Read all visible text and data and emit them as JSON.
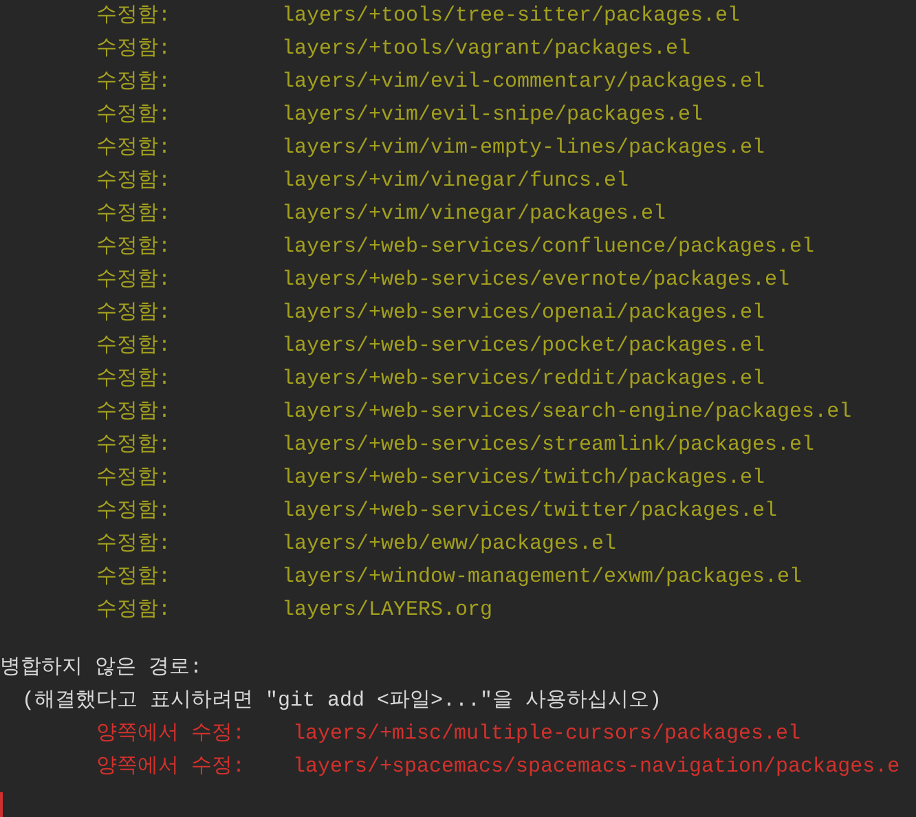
{
  "lines": [
    {
      "kind": "modified",
      "status": "수정함:",
      "path": "layers/+tools/tree-sitter/packages.el"
    },
    {
      "kind": "modified",
      "status": "수정함:",
      "path": "layers/+tools/vagrant/packages.el"
    },
    {
      "kind": "modified",
      "status": "수정함:",
      "path": "layers/+vim/evil-commentary/packages.el"
    },
    {
      "kind": "modified",
      "status": "수정함:",
      "path": "layers/+vim/evil-snipe/packages.el"
    },
    {
      "kind": "modified",
      "status": "수정함:",
      "path": "layers/+vim/vim-empty-lines/packages.el"
    },
    {
      "kind": "modified",
      "status": "수정함:",
      "path": "layers/+vim/vinegar/funcs.el"
    },
    {
      "kind": "modified",
      "status": "수정함:",
      "path": "layers/+vim/vinegar/packages.el"
    },
    {
      "kind": "modified",
      "status": "수정함:",
      "path": "layers/+web-services/confluence/packages.el"
    },
    {
      "kind": "modified",
      "status": "수정함:",
      "path": "layers/+web-services/evernote/packages.el"
    },
    {
      "kind": "modified",
      "status": "수정함:",
      "path": "layers/+web-services/openai/packages.el"
    },
    {
      "kind": "modified",
      "status": "수정함:",
      "path": "layers/+web-services/pocket/packages.el"
    },
    {
      "kind": "modified",
      "status": "수정함:",
      "path": "layers/+web-services/reddit/packages.el"
    },
    {
      "kind": "modified",
      "status": "수정함:",
      "path": "layers/+web-services/search-engine/packages.el"
    },
    {
      "kind": "modified",
      "status": "수정함:",
      "path": "layers/+web-services/streamlink/packages.el"
    },
    {
      "kind": "modified",
      "status": "수정함:",
      "path": "layers/+web-services/twitch/packages.el"
    },
    {
      "kind": "modified",
      "status": "수정함:",
      "path": "layers/+web-services/twitter/packages.el"
    },
    {
      "kind": "modified",
      "status": "수정함:",
      "path": "layers/+web/eww/packages.el"
    },
    {
      "kind": "modified",
      "status": "수정함:",
      "path": "layers/+window-management/exwm/packages.el"
    },
    {
      "kind": "modified",
      "status": "수정함:",
      "path": "layers/LAYERS.org"
    },
    {
      "kind": "blank"
    },
    {
      "kind": "header",
      "text": "병합하지 않은 경로:"
    },
    {
      "kind": "hint",
      "text": "(해결했다고 표시하려면 \"git add <파일>...\"을 사용하십시오)"
    },
    {
      "kind": "conflict",
      "status": "양쪽에서 수정:",
      "path": "layers/+misc/multiple-cursors/packages.el"
    },
    {
      "kind": "conflict",
      "status": "양쪽에서 수정:",
      "path": "layers/+spacemacs/spacemacs-navigation/packages.e"
    },
    {
      "kind": "cursor"
    }
  ]
}
